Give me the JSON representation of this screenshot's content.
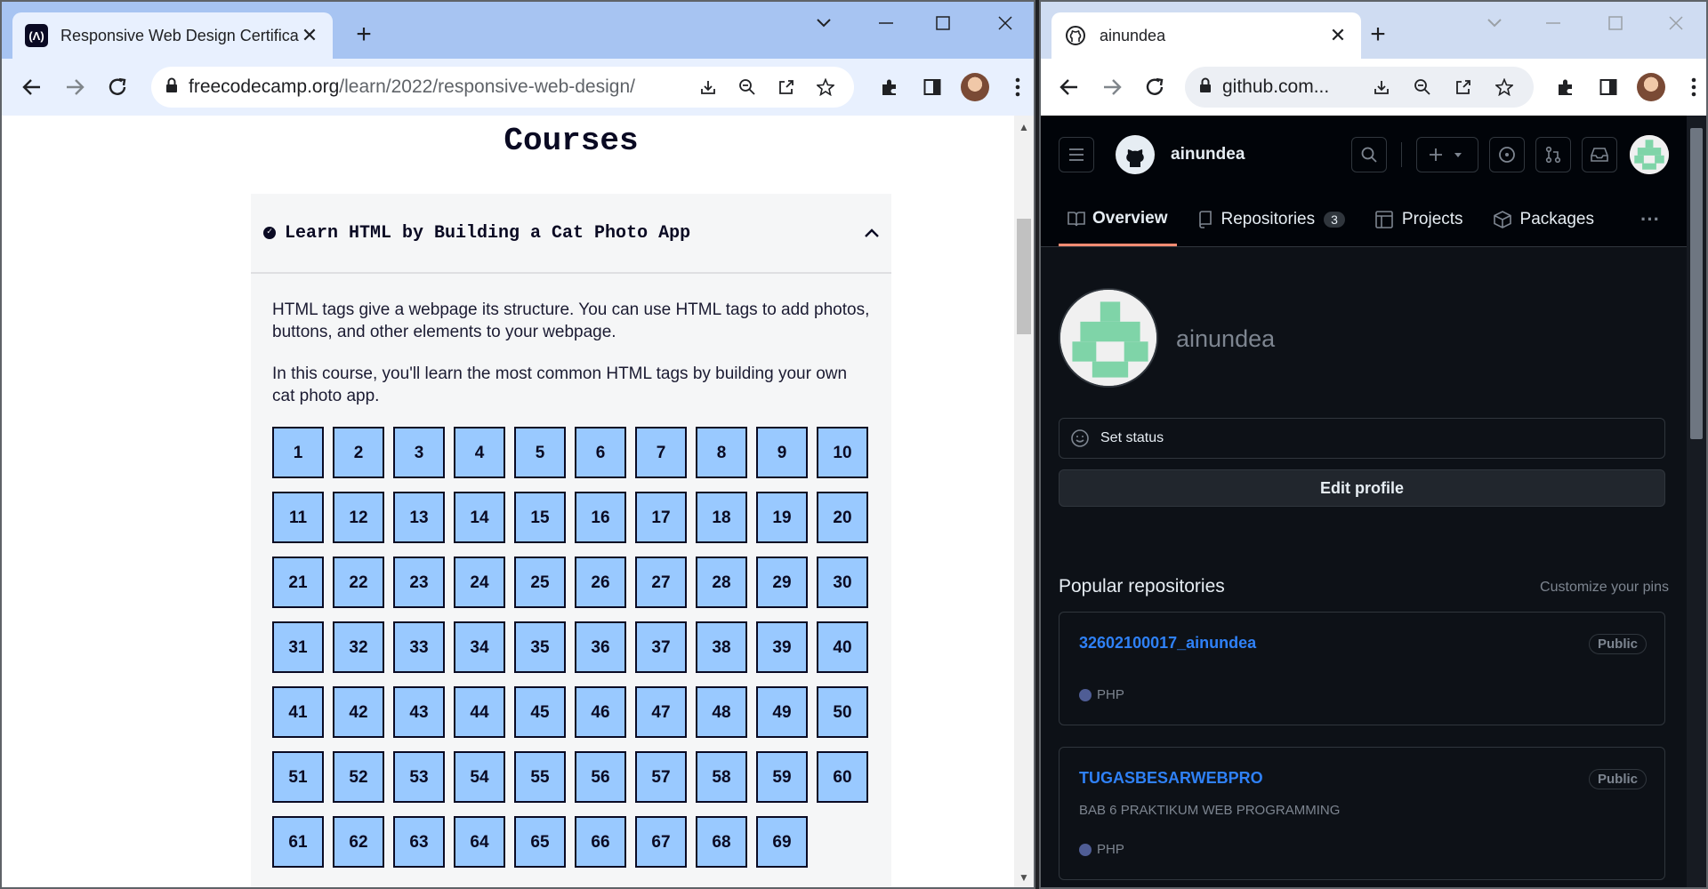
{
  "left_window": {
    "tab_title": "Responsive Web Design Certificat",
    "url_domain": "freecodecamp.org",
    "url_path": "/learn/2022/responsive-web-design/",
    "page_heading": "Courses",
    "course": {
      "title": "Learn HTML by Building a Cat Photo App",
      "paragraph1": "HTML tags give a webpage its structure. You can use HTML tags to add photos, buttons, and other elements to your webpage.",
      "paragraph2": "In this course, you'll learn the most common HTML tags by building your own cat photo app.",
      "steps": [
        "1",
        "2",
        "3",
        "4",
        "5",
        "6",
        "7",
        "8",
        "9",
        "10",
        "11",
        "12",
        "13",
        "14",
        "15",
        "16",
        "17",
        "18",
        "19",
        "20",
        "21",
        "22",
        "23",
        "24",
        "25",
        "26",
        "27",
        "28",
        "29",
        "30",
        "31",
        "32",
        "33",
        "34",
        "35",
        "36",
        "37",
        "38",
        "39",
        "40",
        "41",
        "42",
        "43",
        "44",
        "45",
        "46",
        "47",
        "48",
        "49",
        "50",
        "51",
        "52",
        "53",
        "54",
        "55",
        "56",
        "57",
        "58",
        "59",
        "60",
        "61",
        "62",
        "63",
        "64",
        "65",
        "66",
        "67",
        "68",
        "69"
      ]
    }
  },
  "right_window": {
    "tab_title": "ainundea",
    "url": "github.com...",
    "header_username": "ainundea",
    "nav": {
      "overview": "Overview",
      "repositories": "Repositories",
      "repositories_count": "3",
      "projects": "Projects",
      "packages": "Packages",
      "more": "···"
    },
    "profile_name": "ainundea",
    "set_status": "Set status",
    "edit_profile": "Edit profile",
    "popular_title": "Popular repositories",
    "customize_link": "Customize your pins",
    "repos": [
      {
        "name": "32602100017_ainundea",
        "visibility": "Public",
        "description": "",
        "language": "PHP"
      },
      {
        "name": "TUGASBESARWEBPRO",
        "visibility": "Public",
        "description": "BAB 6 PRAKTIKUM WEB PROGRAMMING",
        "language": "PHP"
      }
    ]
  },
  "colors": {
    "fcc_step_fill": "#99c9ff",
    "github_bg": "#0d1117",
    "github_link": "#2f81f7",
    "github_tab_underline": "#fd8c73",
    "php_dot": "#4f5d95"
  }
}
